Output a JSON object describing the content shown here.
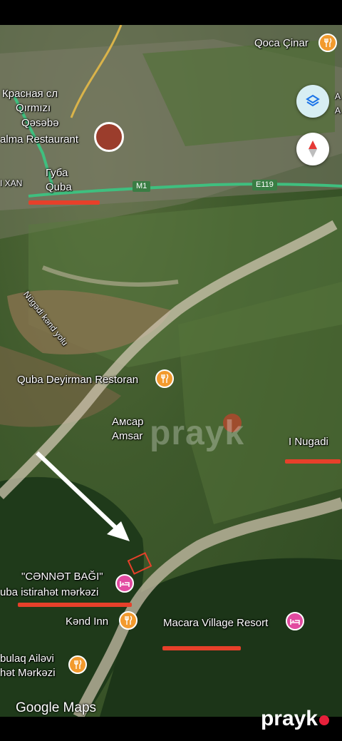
{
  "labels": {
    "qoca_cinar": "Qoca Çinar",
    "krasnaya": "Красная сл",
    "qirmizi": "Qırmızı",
    "qesebe": "Qəsəbə",
    "alma_restaurant": "alma Restaurant",
    "xan": "I XAN",
    "guba": "Губа",
    "quba": "Quba",
    "nugadi_road": "Nügədi kənd yolu",
    "quba_deyirman": "Quba Deyirman Restoran",
    "amsar_ru": "Амсар",
    "amsar": "Amsar",
    "nugadi": "I Nugadi",
    "cennet_bagi": "\"CƏNNƏT BAĞI\"",
    "istirahet": "uba istirahət mərkəzi",
    "kend_inn": "Kənd Inn",
    "macara": "Macara Village Resort",
    "bulaq": "bulaq Ailəvi",
    "mərkəzi": "hət Mərkəzi",
    "right_edge_a1": "A",
    "right_edge_a2": "A"
  },
  "roads": {
    "m1": "M1",
    "e119": "E119"
  },
  "watermark": "prayk",
  "google": "Google Maps",
  "brand": "prayk",
  "icons": {
    "food": "fork-knife-icon",
    "hotel": "bed-icon",
    "layers": "layers-icon",
    "compass": "compass-icon"
  },
  "colors": {
    "annotation_red": "#e7402a",
    "food_pin": "#f29a2e",
    "hotel_pin": "#e24aa0",
    "highway": "#3fbf7f"
  }
}
